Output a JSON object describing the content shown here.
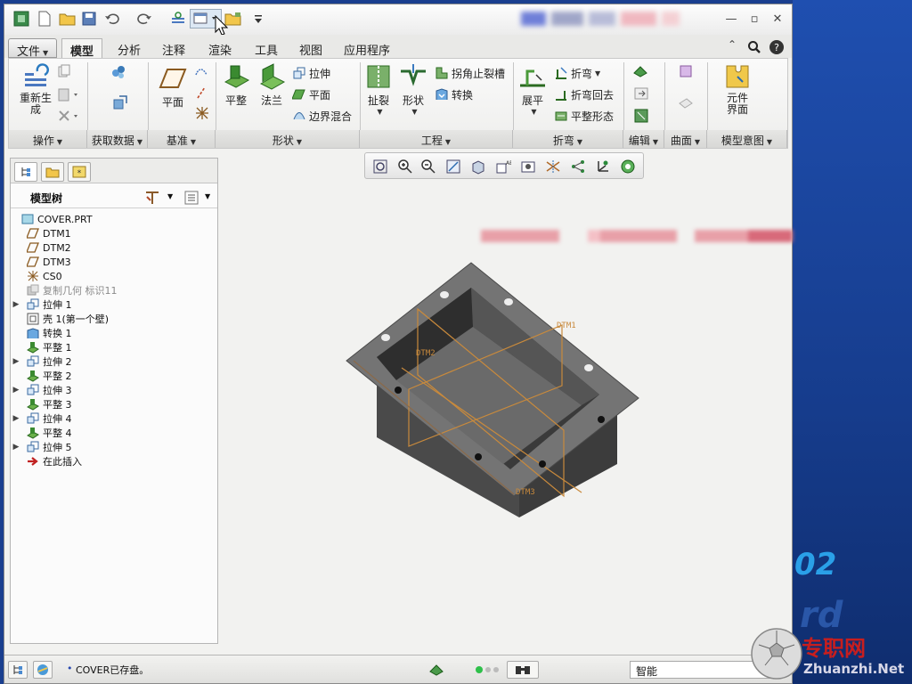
{
  "quick_access": {
    "icons": [
      "app-icon",
      "new-icon",
      "open-icon",
      "save-icon",
      "undo-icon",
      "redo-icon",
      "regenerate-icon",
      "windows-icon",
      "close-window-icon",
      "customize-icon"
    ]
  },
  "ribbon_tabs": [
    "文件",
    "模型",
    "分析",
    "注释",
    "渲染",
    "工具",
    "视图",
    "应用程序"
  ],
  "active_tab": "模型",
  "ribbon": {
    "regenerate": "重新生成",
    "plane": "平面",
    "flat": "平整",
    "flange": "法兰",
    "extrude": "拉伸",
    "planar": "平面",
    "boundary_blend": "边界混合",
    "rip": "扯裂",
    "form": "形状",
    "corner_relief": "拐角止裂槽",
    "convert": "转换",
    "unbend": "展平",
    "bend": "折弯",
    "bend_back": "折弯回去",
    "flat_state": "平整形态",
    "component_interface": "元件界面"
  },
  "ribbon_groups": [
    "操作",
    "获取数据",
    "基准",
    "形状",
    "工程",
    "折弯",
    "编辑",
    "曲面",
    "模型意图"
  ],
  "model_tree": {
    "title": "模型树",
    "items": [
      {
        "label": "COVER.PRT",
        "icon": "part-icon",
        "indent": 0,
        "expand": ""
      },
      {
        "label": "DTM1",
        "icon": "datum-plane-icon",
        "indent": 1,
        "expand": ""
      },
      {
        "label": "DTM2",
        "icon": "datum-plane-icon",
        "indent": 1,
        "expand": ""
      },
      {
        "label": "DTM3",
        "icon": "datum-plane-icon",
        "indent": 1,
        "expand": ""
      },
      {
        "label": "CS0",
        "icon": "coordinate-system-icon",
        "indent": 1,
        "expand": ""
      },
      {
        "label": "复制几何  标识11",
        "icon": "copy-geometry-icon",
        "indent": 1,
        "expand": "",
        "grey": true
      },
      {
        "label": "拉伸 1",
        "icon": "extrude-icon",
        "indent": 1,
        "expand": "▶"
      },
      {
        "label": "壳 1(第一个壁)",
        "icon": "shell-icon",
        "indent": 1,
        "expand": ""
      },
      {
        "label": "转换 1",
        "icon": "convert-icon",
        "indent": 1,
        "expand": ""
      },
      {
        "label": "平整 1",
        "icon": "flat-wall-icon",
        "indent": 1,
        "expand": ""
      },
      {
        "label": "拉伸 2",
        "icon": "extrude-icon",
        "indent": 1,
        "expand": "▶"
      },
      {
        "label": "平整 2",
        "icon": "flat-wall-icon",
        "indent": 1,
        "expand": ""
      },
      {
        "label": "拉伸 3",
        "icon": "extrude-icon",
        "indent": 1,
        "expand": "▶"
      },
      {
        "label": "平整 3",
        "icon": "flat-wall-icon",
        "indent": 1,
        "expand": ""
      },
      {
        "label": "拉伸 4",
        "icon": "extrude-icon",
        "indent": 1,
        "expand": "▶"
      },
      {
        "label": "平整 4",
        "icon": "flat-wall-icon",
        "indent": 1,
        "expand": ""
      },
      {
        "label": "拉伸 5",
        "icon": "extrude-icon",
        "indent": 1,
        "expand": "▶"
      },
      {
        "label": "在此插入",
        "icon": "insert-here-icon",
        "indent": 1,
        "expand": ""
      }
    ]
  },
  "viewport": {
    "datum_labels": [
      "DTM1",
      "DTM2",
      "DTM3"
    ]
  },
  "status": {
    "message": "COVER已存盘。",
    "filter_value": "智能"
  },
  "watermark": {
    "desk_number": "02",
    "logo_cn": "专职网",
    "logo_en": "Zhuanzhi.Net"
  },
  "colors": {
    "model_face": "#5a5a5a",
    "model_top": "#707070",
    "datum": "#c98a3c",
    "accent_green": "#2e9a3e"
  }
}
